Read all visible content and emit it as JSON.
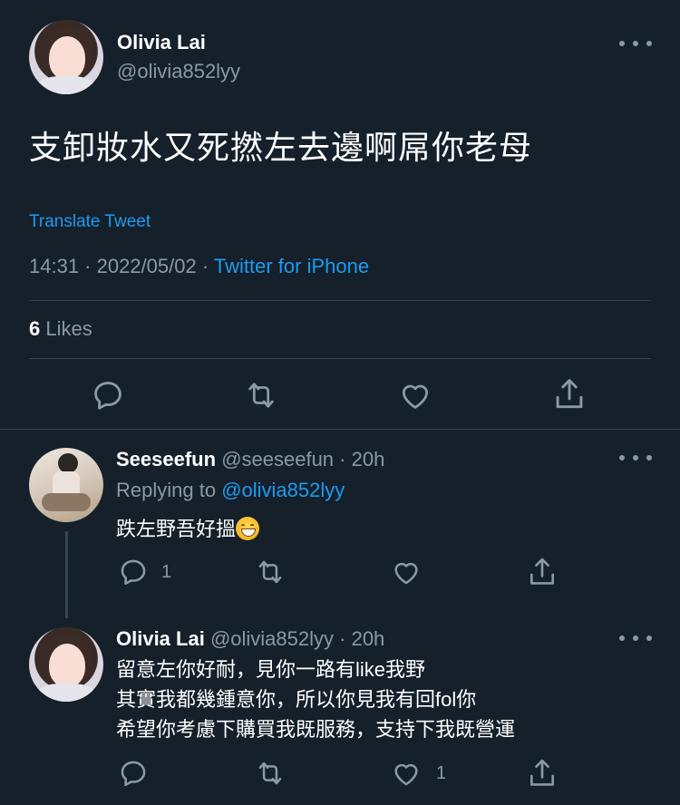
{
  "main_tweet": {
    "author_name": "Olivia Lai",
    "author_handle": "@olivia852lyy",
    "text": "支卸妝水又死撚左去邊啊屌你老母",
    "translate_label": "Translate Tweet",
    "time": "14:31",
    "date": "2022/05/02",
    "source": "Twitter for iPhone",
    "likes_count": "6",
    "likes_label": "Likes"
  },
  "replies": [
    {
      "author_name": "Seeseefun",
      "author_handle": "@seeseefun",
      "age": "20h",
      "replying_prefix": "Replying to",
      "replying_to": "@olivia852lyy",
      "text": "跌左野吾好搵",
      "reply_count": "1",
      "like_count": ""
    },
    {
      "author_name": "Olivia Lai",
      "author_handle": "@olivia852lyy",
      "age": "20h",
      "lines": [
        "留意左你好耐，見你一路有like我野",
        "其實我都幾鍾意你，所以你見我有回fol你",
        "希望你考慮下購買我既服務，支持下我既營運"
      ],
      "reply_count": "",
      "like_count": "1"
    }
  ],
  "separator": " · ",
  "colors": {
    "background": "#15202b",
    "accent": "#1d9bf0",
    "secondary_text": "#8b98a5",
    "divider": "#38444d"
  },
  "icons": [
    "more-icon",
    "reply-icon",
    "retweet-icon",
    "like-icon",
    "share-icon",
    "grinning-emoji"
  ]
}
